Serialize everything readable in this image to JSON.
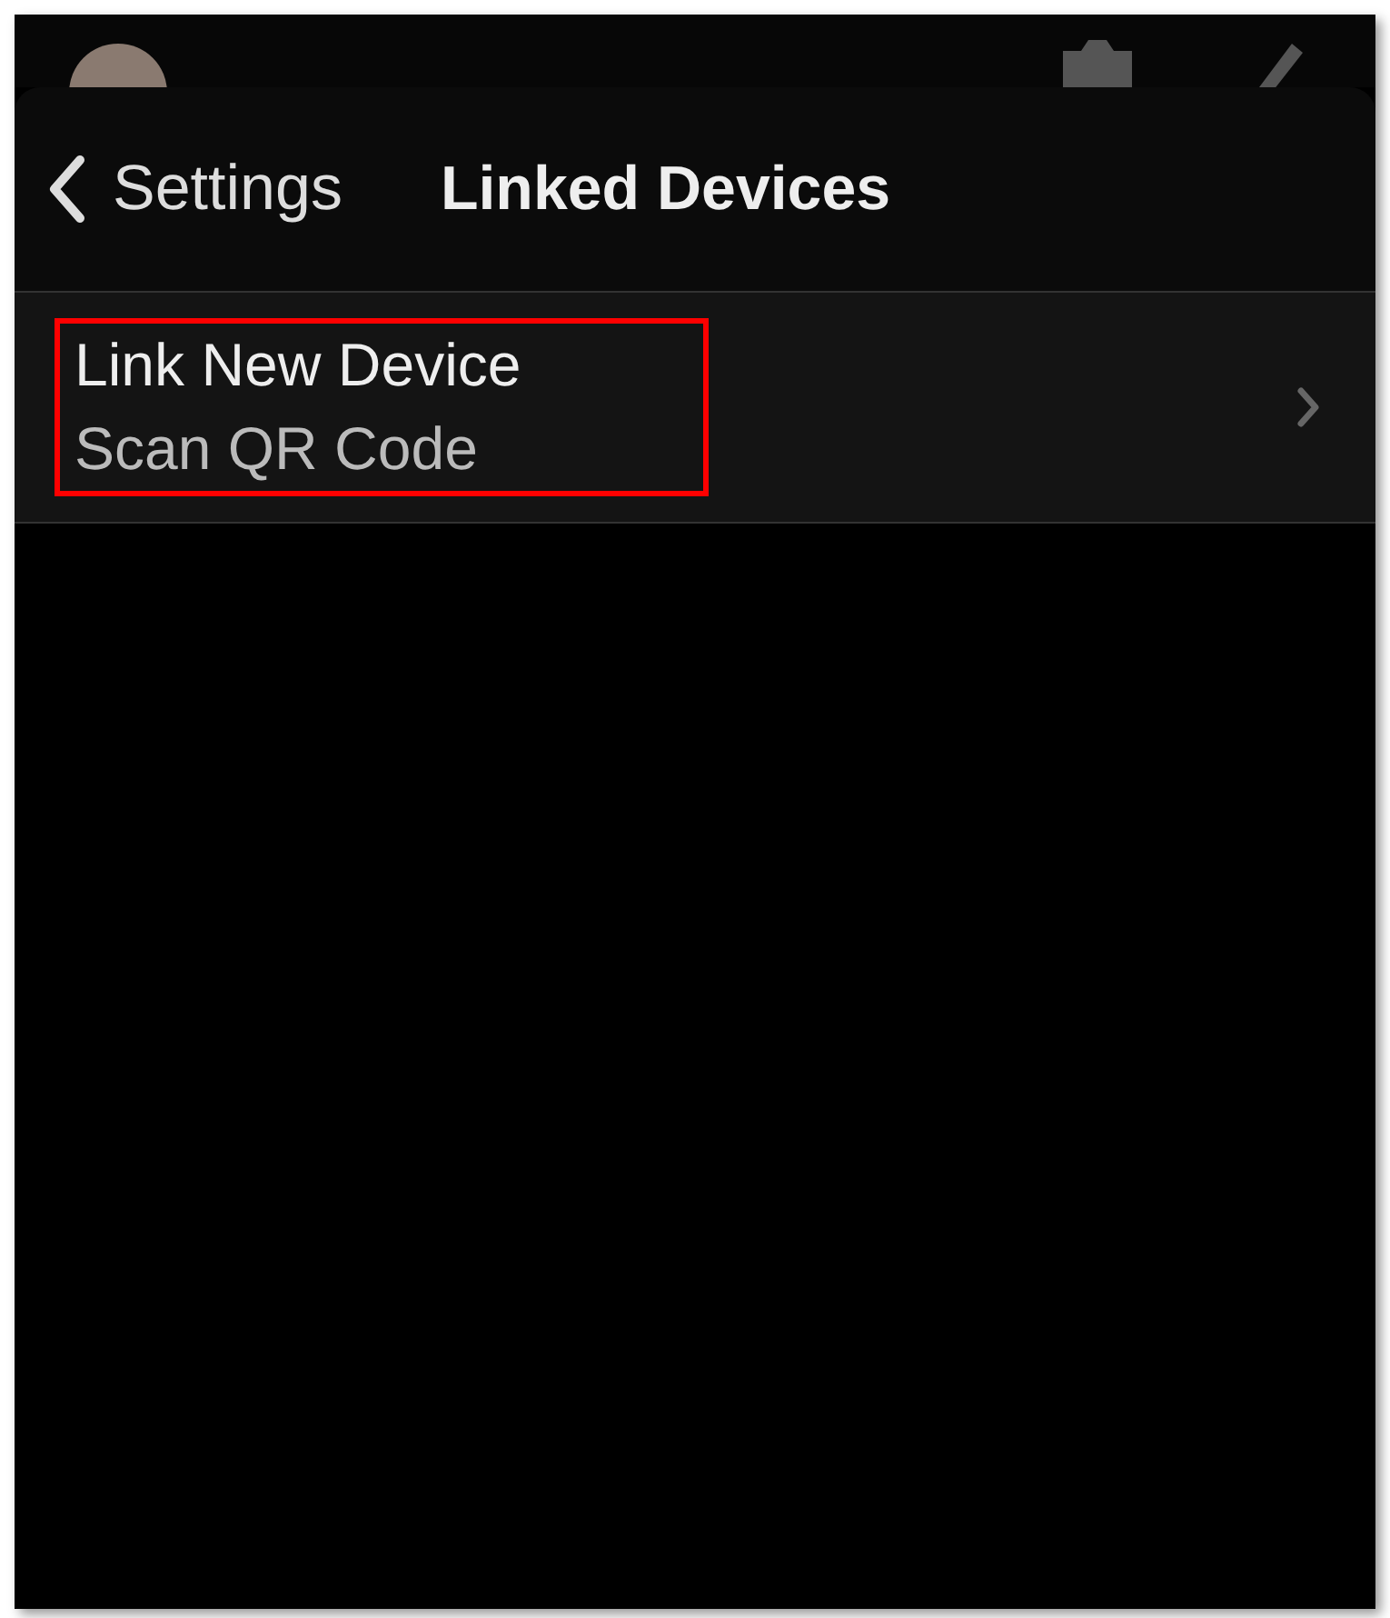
{
  "nav": {
    "back_label": "Settings",
    "title": "Linked Devices"
  },
  "rows": [
    {
      "title": "Link New Device",
      "subtitle": "Scan QR Code",
      "highlighted": true
    }
  ]
}
